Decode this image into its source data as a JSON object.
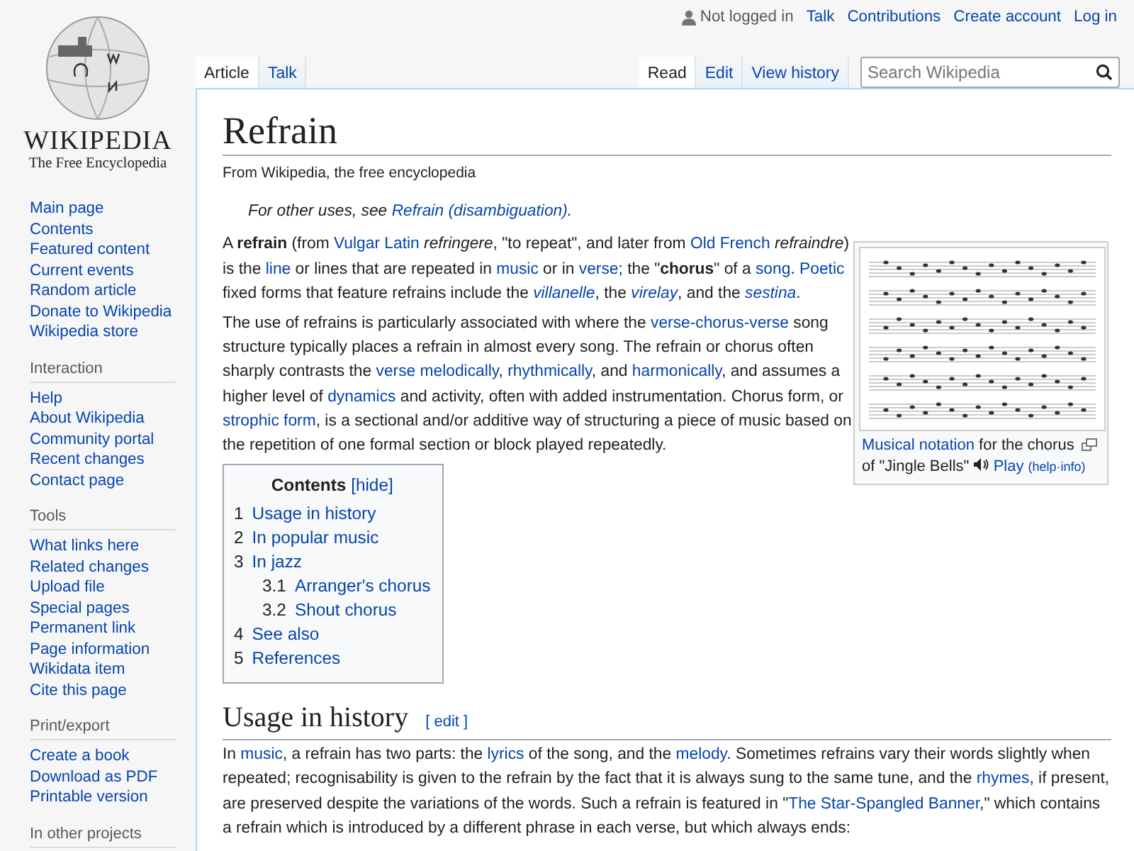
{
  "logo": {
    "wordmark": "WIKIPEDIA",
    "tagline": "The Free Encyclopedia"
  },
  "sidebar": [
    {
      "items": [
        "Main page",
        "Contents",
        "Featured content",
        "Current events",
        "Random article",
        "Donate to Wikipedia",
        "Wikipedia store"
      ]
    },
    {
      "heading": "Interaction",
      "items": [
        "Help",
        "About Wikipedia",
        "Community portal",
        "Recent changes",
        "Contact page"
      ]
    },
    {
      "heading": "Tools",
      "items": [
        "What links here",
        "Related changes",
        "Upload file",
        "Special pages",
        "Permanent link",
        "Page information",
        "Wikidata item",
        "Cite this page"
      ]
    },
    {
      "heading": "Print/export",
      "items": [
        "Create a book",
        "Download as PDF",
        "Printable version"
      ]
    },
    {
      "heading": "In other projects"
    }
  ],
  "personal_tools": {
    "status": "Not logged in",
    "links": [
      "Talk",
      "Contributions",
      "Create account",
      "Log in"
    ]
  },
  "namespace_tabs": [
    {
      "label": "Article",
      "selected": true
    },
    {
      "label": "Talk",
      "selected": false
    }
  ],
  "view_tabs": [
    {
      "label": "Read",
      "selected": true
    },
    {
      "label": "Edit",
      "selected": false
    },
    {
      "label": "View history",
      "selected": false
    }
  ],
  "search": {
    "placeholder": "Search Wikipedia"
  },
  "article": {
    "title": "Refrain",
    "tagline": "From Wikipedia, the free encyclopedia",
    "hatnote": [
      {
        "kind": "text",
        "text": "For other uses, see "
      },
      {
        "kind": "link",
        "text": "Refrain (disambiguation)"
      },
      {
        "kind": "text",
        "text": "."
      }
    ],
    "paragraphs": [
      [
        {
          "kind": "text",
          "text": "A **refrain** (from "
        },
        {
          "kind": "link",
          "text": "Vulgar Latin"
        },
        {
          "kind": "text",
          "text": " *refringere*, \"to repeat\", and later from "
        },
        {
          "kind": "link",
          "text": "Old French"
        },
        {
          "kind": "text",
          "text": " *refraindre*) is the "
        },
        {
          "kind": "link",
          "text": "line"
        },
        {
          "kind": "text",
          "text": " or lines that are repeated in "
        },
        {
          "kind": "link",
          "text": "music"
        },
        {
          "kind": "text",
          "text": " or in "
        },
        {
          "kind": "link",
          "text": "verse"
        },
        {
          "kind": "text",
          "text": "; the \"**chorus**\" of a "
        },
        {
          "kind": "link",
          "text": "song"
        },
        {
          "kind": "text",
          "text": ". "
        },
        {
          "kind": "link",
          "text": "Poetic"
        },
        {
          "kind": "text",
          "text": " fixed forms that feature refrains include the "
        },
        {
          "kind": "link",
          "text": "*villanelle*"
        },
        {
          "kind": "text",
          "text": ", the "
        },
        {
          "kind": "link",
          "text": "*virelay*"
        },
        {
          "kind": "text",
          "text": ", and the "
        },
        {
          "kind": "link",
          "text": "*sestina*"
        },
        {
          "kind": "text",
          "text": "."
        }
      ],
      [
        {
          "kind": "text",
          "text": "The use of refrains is particularly associated with where the "
        },
        {
          "kind": "link",
          "text": "verse-chorus-verse"
        },
        {
          "kind": "text",
          "text": " song structure typically places a refrain in almost every song. The refrain or chorus often sharply contrasts the "
        },
        {
          "kind": "link",
          "text": "verse melodically"
        },
        {
          "kind": "text",
          "text": ", "
        },
        {
          "kind": "link",
          "text": "rhythmically"
        },
        {
          "kind": "text",
          "text": ", and "
        },
        {
          "kind": "link",
          "text": "harmonically"
        },
        {
          "kind": "text",
          "text": ", and assumes a higher level of "
        },
        {
          "kind": "link",
          "text": "dynamics"
        },
        {
          "kind": "text",
          "text": " and activity, often with added instrumentation. Chorus form, or "
        },
        {
          "kind": "link",
          "text": "strophic form"
        },
        {
          "kind": "text",
          "text": ", is a sectional and/or additive way of structuring a piece of music based on the repetition of one formal section or block played repeatedly."
        }
      ]
    ],
    "figure": {
      "caption": [
        {
          "kind": "link",
          "text": "Musical notation"
        },
        {
          "kind": "text",
          "text": " for the chorus of \"Jingle Bells\" "
        }
      ],
      "play": "Play",
      "help_links": "(help·info)"
    },
    "toc": {
      "title": "Contents",
      "toggle": "[hide]",
      "items": [
        {
          "number": "1",
          "label": "Usage in history"
        },
        {
          "number": "2",
          "label": "In popular music"
        },
        {
          "number": "3",
          "label": "In jazz",
          "children": [
            {
              "number": "3.1",
              "label": "Arranger's chorus"
            },
            {
              "number": "3.2",
              "label": "Shout chorus"
            }
          ]
        },
        {
          "number": "4",
          "label": "See also"
        },
        {
          "number": "5",
          "label": "References"
        }
      ]
    },
    "sections": [
      {
        "heading": "Usage in history",
        "edit": "[ edit ]",
        "paragraphs": [
          [
            {
              "kind": "text",
              "text": "In "
            },
            {
              "kind": "link",
              "text": "music"
            },
            {
              "kind": "text",
              "text": ", a refrain has two parts: the "
            },
            {
              "kind": "link",
              "text": "lyrics"
            },
            {
              "kind": "text",
              "text": " of the song, and the "
            },
            {
              "kind": "link",
              "text": "melody"
            },
            {
              "kind": "text",
              "text": ". Sometimes refrains vary their words slightly when repeated; recognisability is given to the refrain by the fact that it is always sung to the same tune, and the "
            },
            {
              "kind": "link",
              "text": "rhymes"
            },
            {
              "kind": "text",
              "text": ", if present, are preserved despite the variations of the words. Such a refrain is featured in \""
            },
            {
              "kind": "link",
              "text": "The Star-Spangled Banner"
            },
            {
              "kind": "text",
              "text": ",\" which contains a refrain which is introduced by a different phrase in each verse, but which always ends:"
            }
          ]
        ]
      }
    ]
  }
}
